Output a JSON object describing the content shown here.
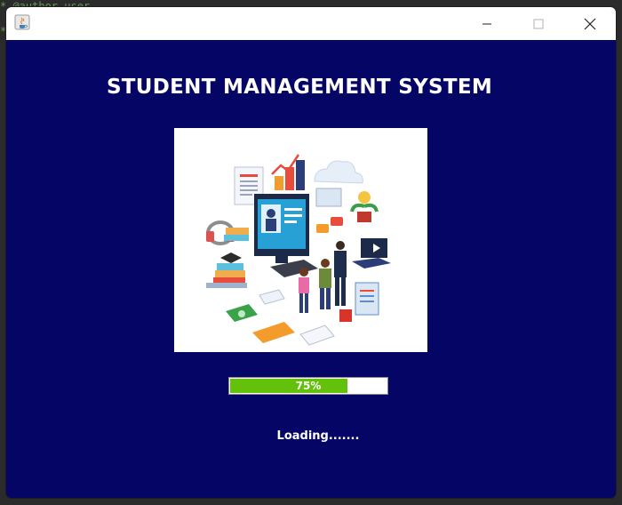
{
  "background_editor": {
    "line1": "* @author user",
    "line2": "*"
  },
  "window": {
    "title": "",
    "controls": {
      "minimize_icon": "minimize-icon",
      "maximize_icon": "maximize-icon",
      "close_icon": "close-icon"
    }
  },
  "app": {
    "heading": "STUDENT MANAGEMENT SYSTEM",
    "illustration_icon": "education-illustration",
    "progress": {
      "value": 0.75,
      "label": "75%"
    },
    "status": "Loading......."
  },
  "colors": {
    "window_background": "#050566",
    "progress_fill": "#63c00b",
    "text": "#ffffff"
  }
}
